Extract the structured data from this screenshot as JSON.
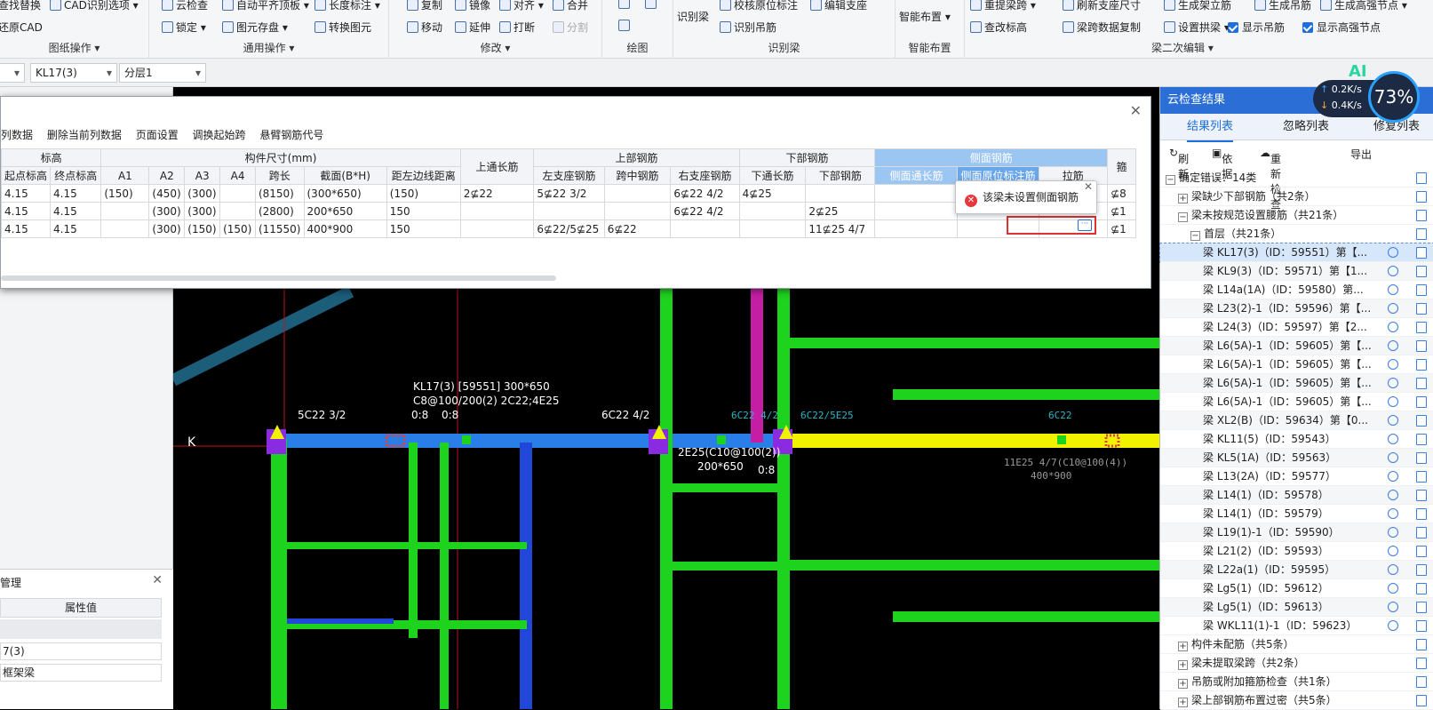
{
  "ribbon": {
    "g1": {
      "items": [
        "查找替换",
        "还原CAD"
      ],
      "label": "图纸操作 ▾",
      "cad_opt": "CAD识别选项 ▾"
    },
    "g2": {
      "items": [
        "云检查",
        "自动平齐顶板 ▾",
        "长度标注 ▾",
        "锁定 ▾",
        "图元存盘 ▾",
        "转换图元"
      ],
      "label": "通用操作 ▾"
    },
    "g3": {
      "items": [
        "复制",
        "镜像",
        "对齐 ▾",
        "合并",
        "移动",
        "延伸",
        "打断",
        "分割"
      ],
      "label": "修改 ▾"
    },
    "g4": {
      "label": "绘图"
    },
    "g5": {
      "items": [
        "识别梁",
        "校核原位标注",
        "编辑支座",
        "识别吊筋"
      ],
      "label": "识别梁"
    },
    "g6": {
      "items": [
        "智能布置 ▾"
      ],
      "label": "智能布置"
    },
    "g7": {
      "items": [
        "重提梁跨 ▾",
        "刷新支座尺寸",
        "生成架立筋",
        "生成吊筋",
        "生成高强节点 ▾",
        "查改标高",
        "梁跨数据复制",
        "设置拱梁 ▾",
        "显示吊筋",
        "显示高强节点"
      ],
      "label": "梁二次编辑 ▾"
    }
  },
  "toolbar2": {
    "member": "KL17(3)",
    "layer": "分层1"
  },
  "dialog": {
    "menu": [
      "列数据",
      "删除当前列数据",
      "页面设置",
      "调换起始跨",
      "悬臂钢筋代号"
    ],
    "head1": [
      "标高",
      "构件尺寸(mm)",
      "上通长筋",
      "上部钢筋",
      "下部钢筋",
      "侧面钢筋",
      "箍"
    ],
    "head2": [
      "起点标高",
      "终点标高",
      "A1",
      "A2",
      "A3",
      "A4",
      "跨长",
      "截面(B*H)",
      "距左边线距离",
      "左支座钢筋",
      "跨中钢筋",
      "右支座钢筋",
      "下通长筋",
      "下部钢筋",
      "侧面通长筋",
      "侧面原位标注筋",
      "拉筋"
    ],
    "rows": [
      [
        "4.15",
        "4.15",
        "4.15",
        "(150)",
        "(450)",
        "(300)",
        "",
        "(8150)",
        "(300*650)",
        "(150)",
        "2⊈22",
        "5⊈22 3/2",
        "",
        "6⊈22 4/2",
        "4⊈25",
        "",
        "",
        "",
        "",
        "⊈8"
      ],
      [
        "4.15",
        "4.15",
        "4.15",
        "",
        "(300)",
        "(300)",
        "",
        "(2800)",
        "200*650",
        "150",
        "",
        "",
        "",
        "6⊈22 4/2",
        "",
        "2⊈25",
        "",
        "",
        "",
        "⊈1"
      ],
      [
        "4.15",
        "4.15",
        "4.15",
        "",
        "(300)",
        "(150)",
        "(150)",
        "(11550)",
        "400*900",
        "150",
        "",
        "6⊈22/5⊈25",
        "6⊈22",
        "",
        "",
        "11⊈25 4/7",
        "",
        "",
        "",
        "⊈1"
      ]
    ],
    "tooltip": "该梁未设置侧面钢筋",
    "more": "···"
  },
  "right": {
    "title": "云检查结果",
    "tabs": [
      "结果列表",
      "忽略列表",
      "修复列表"
    ],
    "tools": [
      "刷新",
      "依据",
      "重新检查",
      "导出"
    ],
    "tree": [
      {
        "t": "确定错误：14类",
        "lv": 0,
        "pm": "−"
      },
      {
        "t": "梁缺少下部钢筋（共2条）",
        "lv": 1,
        "pm": "+"
      },
      {
        "t": "梁未按规范设置腰筋（共21条）",
        "lv": 1,
        "pm": "−"
      },
      {
        "t": "首层（共21条）",
        "lv": 2,
        "pm": "−"
      },
      {
        "t": "梁 KL17(3)（ID：59551）第【...",
        "lv": 3,
        "sel": true
      },
      {
        "t": "梁 KL9(3)（ID：59571）第【1...",
        "lv": 3
      },
      {
        "t": "梁 L14a(1A)（ID：59580）第...",
        "lv": 3
      },
      {
        "t": "梁 L23(2)-1（ID：59596）第【...",
        "lv": 3
      },
      {
        "t": "梁 L24(3)（ID：59597）第【2...",
        "lv": 3
      },
      {
        "t": "梁 L6(5A)-1（ID：59605）第【...",
        "lv": 3
      },
      {
        "t": "梁 L6(5A)-1（ID：59605）第【...",
        "lv": 3
      },
      {
        "t": "梁 L6(5A)-1（ID：59605）第【...",
        "lv": 3
      },
      {
        "t": "梁 L6(5A)-1（ID：59605）第【...",
        "lv": 3
      },
      {
        "t": "梁 XL2(B)（ID：59634）第【0...",
        "lv": 3
      },
      {
        "t": "梁 KL11(5)（ID：59543）",
        "lv": 3
      },
      {
        "t": "梁 KL5(1A)（ID：59563）",
        "lv": 3
      },
      {
        "t": "梁 L13(2A)（ID：59577）",
        "lv": 3
      },
      {
        "t": "梁 L14(1)（ID：59578）",
        "lv": 3
      },
      {
        "t": "梁 L14(1)（ID：59579）",
        "lv": 3
      },
      {
        "t": "梁 L19(1)-1（ID：59590）",
        "lv": 3
      },
      {
        "t": "梁 L21(2)（ID：59593）",
        "lv": 3
      },
      {
        "t": "梁 L22a(1)（ID：59595）",
        "lv": 3
      },
      {
        "t": "梁 Lg5(1)（ID：59612）",
        "lv": 3
      },
      {
        "t": "梁 Lg5(1)（ID：59613）",
        "lv": 3
      },
      {
        "t": "梁 WKL11(1)-1（ID：59623）",
        "lv": 3
      },
      {
        "t": "构件未配筋（共5条）",
        "lv": 1,
        "pm": "+"
      },
      {
        "t": "梁未提取梁跨（共2条）",
        "lv": 1,
        "pm": "+"
      },
      {
        "t": "吊筋或附加箍筋检查（共1条）",
        "lv": 1,
        "pm": "+"
      },
      {
        "t": "梁上部钢筋布置过密（共5条）",
        "lv": 1,
        "pm": "+"
      }
    ]
  },
  "speed": {
    "up": "0.2K/s",
    "down": "0.4K/s",
    "pct": "73%",
    "ai": "AI"
  },
  "prop": {
    "title": "管理",
    "col": "属性值",
    "v1": "7(3)",
    "v2": "框架梁"
  },
  "cad": {
    "labels": [
      "KL17(3) [59551] 300*650",
      "C8@100/200(2) 2C22;4E25",
      "5C22 3/2",
      "6C22 4/2",
      "6C22 4/2",
      "6C22/5E25",
      "6C22",
      "2E25(C10@100(2))",
      "200*650",
      "11E25 4/7(C10@100(4))",
      "400*900",
      "0:8",
      "K"
    ]
  }
}
